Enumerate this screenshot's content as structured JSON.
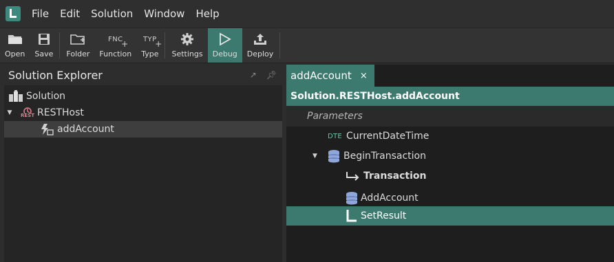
{
  "menubar": {
    "items": [
      "File",
      "Edit",
      "Solution",
      "Window",
      "Help"
    ]
  },
  "toolbar": {
    "open": "Open",
    "save": "Save",
    "folder": "Folder",
    "function": "Function",
    "function_icon_text": "FNC",
    "type": "Type",
    "type_icon_text": "TYP",
    "settings": "Settings",
    "debug": "Debug",
    "deploy": "Deploy"
  },
  "explorer": {
    "title": "Solution Explorer",
    "tree": {
      "solution": "Solution",
      "resthost": "RESTHost",
      "resthost_icon_text": "REST",
      "addaccount": "addAccount"
    }
  },
  "editor": {
    "tab_label": "addAccount",
    "tab_close": "×",
    "path": "Solution.RESTHost.addAccount",
    "parameters_label": "Parameters",
    "dte_label": "DTE",
    "nodes": {
      "current_datetime": "CurrentDateTime",
      "begin_transaction": "BeginTransaction",
      "transaction": "Transaction",
      "add_account": "AddAccount",
      "set_result": "SetResult"
    }
  },
  "colors": {
    "accent": "#3c7a6f",
    "background": "#1e1e1e",
    "panel": "#252526"
  }
}
